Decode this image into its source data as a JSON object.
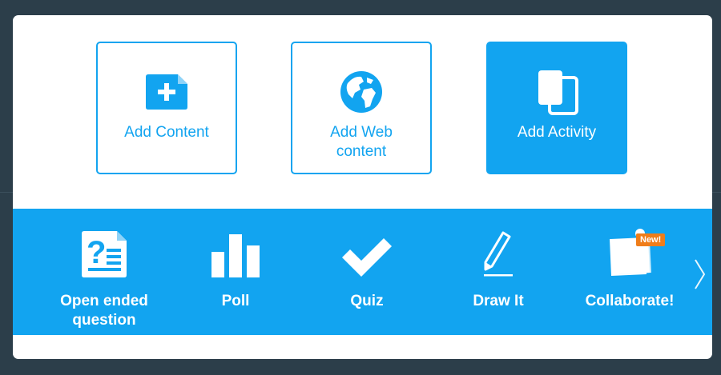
{
  "tiles": [
    {
      "label": "Add Content",
      "icon": "file-plus-icon",
      "active": false
    },
    {
      "label": "Add Web content",
      "icon": "globe-icon",
      "active": false
    },
    {
      "label": "Add Activity",
      "icon": "copy-icon",
      "active": true
    }
  ],
  "activities": [
    {
      "label": "Open ended question",
      "icon": "question-document-icon"
    },
    {
      "label": "Poll",
      "icon": "bar-chart-icon"
    },
    {
      "label": "Quiz",
      "icon": "checkmark-icon"
    },
    {
      "label": "Draw It",
      "icon": "pencil-icon"
    },
    {
      "label": "Collaborate!",
      "icon": "sticky-note-icon",
      "badge": "New!"
    }
  ],
  "next_icon": "chevron-right-icon",
  "colors": {
    "accent": "#12a4f0",
    "badge": "#ef7d1a",
    "backdrop": "#2c3e4a"
  }
}
